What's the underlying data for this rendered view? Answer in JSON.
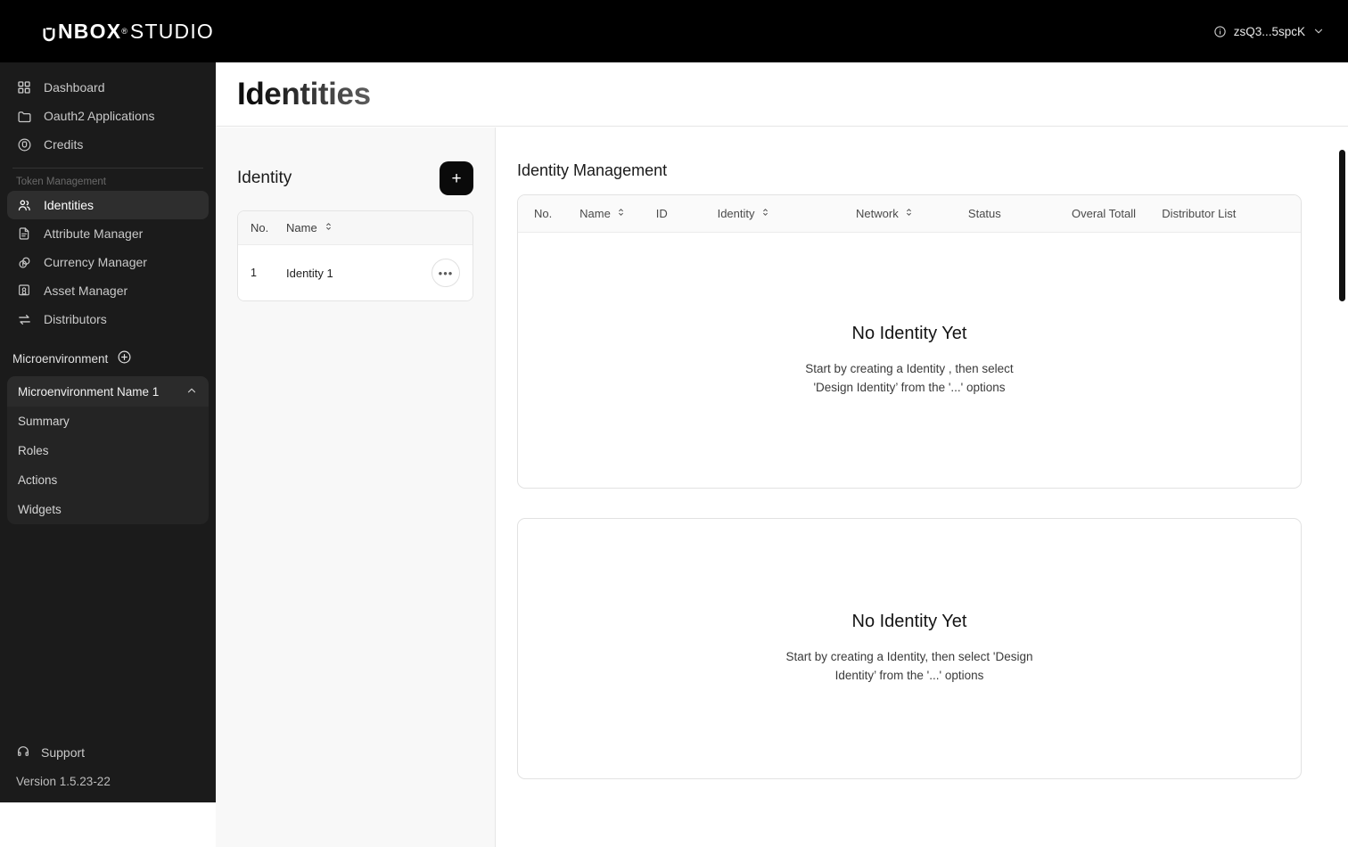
{
  "topbar": {
    "brand_bold": "NBOX",
    "brand_reg": "®",
    "brand_light": "STUDIO",
    "brand_icon": "u-logo-icon",
    "user_label": "zsQ3...5spcK",
    "user_info_icon": "info-circle-icon",
    "user_chevron_icon": "chevron-down-icon"
  },
  "sidebar": {
    "top_items": [
      {
        "label": "Dashboard",
        "icon": "grid-icon",
        "active": false
      },
      {
        "label": "Oauth2 Applications",
        "icon": "folder-icon",
        "active": false
      },
      {
        "label": "Credits",
        "icon": "credits-circle-icon",
        "active": false
      }
    ],
    "section_label": "Token Management",
    "token_items": [
      {
        "label": "Identities",
        "icon": "users-icon",
        "active": true
      },
      {
        "label": "Attribute Manager",
        "icon": "document-icon",
        "active": false
      },
      {
        "label": "Currency Manager",
        "icon": "coins-icon",
        "active": false
      },
      {
        "label": "Asset Manager",
        "icon": "certificate-icon",
        "active": false
      },
      {
        "label": "Distributors",
        "icon": "transfer-arrows-icon",
        "active": false
      }
    ],
    "micro": {
      "header": "Microenvironment",
      "add_icon": "plus-circle-icon",
      "group_title": "Microenvironment Name 1",
      "collapse_icon": "chevron-up-icon",
      "sub_items": [
        "Summary",
        "Roles",
        "Actions",
        "Widgets"
      ]
    },
    "support": {
      "label": "Support",
      "icon": "headset-icon"
    },
    "version": "Version 1.5.23-22"
  },
  "header": {
    "title": "Identities"
  },
  "identity_panel": {
    "title": "Identity",
    "add_button_label": "+",
    "add_button_icon": "plus-icon",
    "columns": [
      {
        "label": "No.",
        "sortable": false
      },
      {
        "label": "Name",
        "sortable": true,
        "sort_icon": "sort-updown-icon"
      }
    ],
    "rows": [
      {
        "no": "1",
        "name": "Identity 1",
        "menu_label": "•••",
        "menu_icon": "ellipsis-icon"
      }
    ]
  },
  "main": {
    "title": "Identity Management",
    "columns": [
      {
        "label": "No.",
        "sortable": false,
        "width_class": "w-no"
      },
      {
        "label": "Name",
        "sortable": true,
        "width_class": "w-name",
        "sort_icon": "sort-updown-icon"
      },
      {
        "label": "ID",
        "sortable": false,
        "width_class": "w-id"
      },
      {
        "label": "Identity",
        "sortable": true,
        "width_class": "w-iden",
        "sort_icon": "sort-updown-icon"
      },
      {
        "label": "Network",
        "sortable": true,
        "width_class": "w-net",
        "sort_icon": "sort-updown-icon"
      },
      {
        "label": "Status",
        "sortable": false,
        "width_class": "w-stat"
      },
      {
        "label": "Overal Totall",
        "sortable": false,
        "width_class": "w-tot"
      },
      {
        "label": "Distributor List",
        "sortable": false,
        "width_class": "w-dist"
      }
    ],
    "empty_top": {
      "title": "No Identity Yet",
      "subtitle": "Start by creating a Identity , then select 'Design Identity’ from the '...' options"
    },
    "empty_bottom": {
      "title": "No Identity Yet",
      "subtitle": "Start by creating a Identity, then select 'Design Identity’ from the '...' options"
    }
  },
  "colors": {
    "topbar_bg": "#000000",
    "sidebar_bg": "#1b1b1b",
    "sidebar_active": "#2e2e2e",
    "panel_bg": "#f8f8f8",
    "accent": "#0a0a0a",
    "border": "#e2e2e2"
  }
}
